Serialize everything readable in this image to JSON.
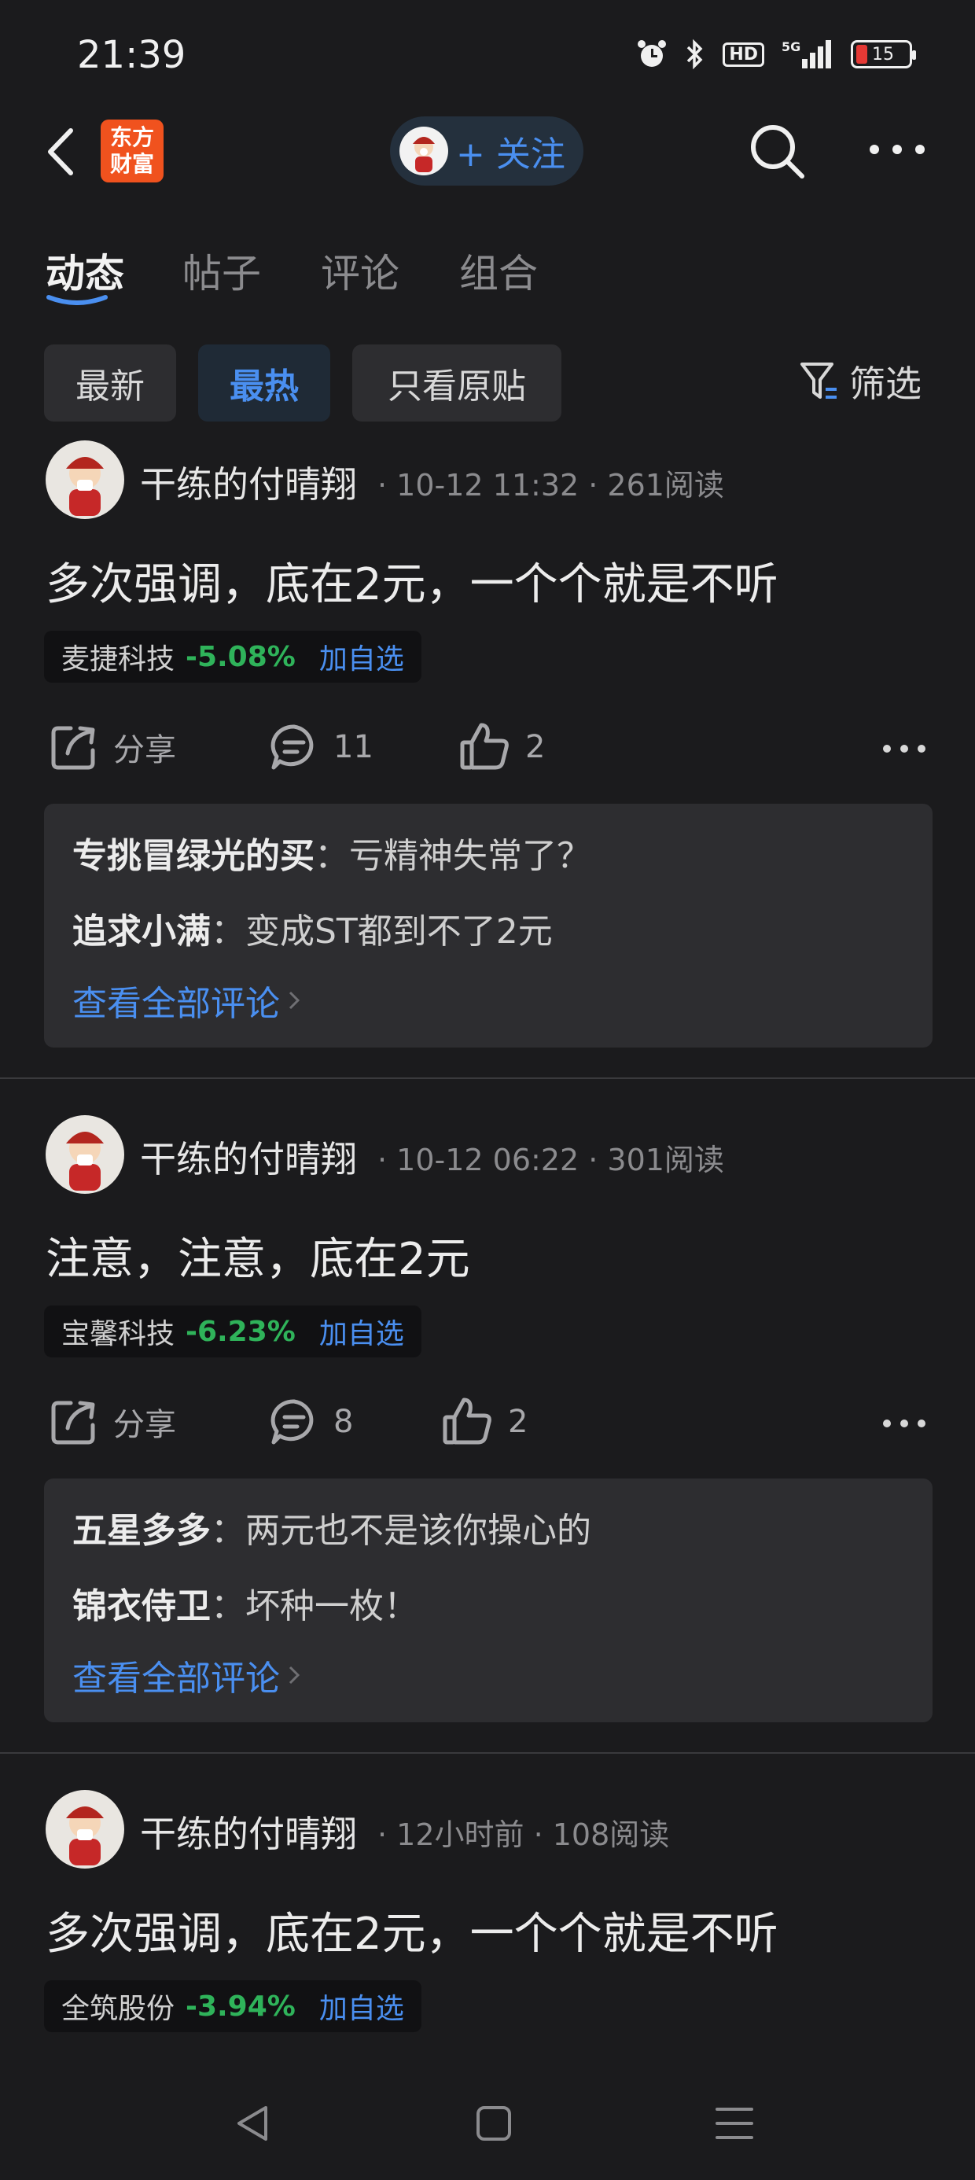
{
  "status_bar": {
    "time": "21:39",
    "hd": "HD",
    "network": "5G",
    "battery": "15"
  },
  "header": {
    "logo_text_line1": "东方",
    "logo_text_line2": "财富",
    "follow_label": "+ 关注"
  },
  "tabs": [
    {
      "label": "动态",
      "active": true
    },
    {
      "label": "帖子",
      "active": false
    },
    {
      "label": "评论",
      "active": false
    },
    {
      "label": "组合",
      "active": false
    }
  ],
  "filters": {
    "chips": [
      "最新",
      "最热",
      "只看原贴"
    ],
    "active": "最热",
    "filter_label": "筛选"
  },
  "posts": [
    {
      "author": "干练的付晴翔",
      "meta": "· 10-12 11:32 · 261阅读",
      "text": "多次强调，底在2元，一个个就是不听",
      "stock": {
        "name": "麦捷科技",
        "change": "-5.08%",
        "add": "加自选"
      },
      "share": "分享",
      "comments": "11",
      "likes": "2",
      "comment_items": [
        {
          "user": "专挑冒绿光的买",
          "sep": "：",
          "text": "亏精神失常了？"
        },
        {
          "user": "追求小满",
          "sep": "：",
          "text": "变成ST都到不了2元"
        }
      ],
      "view_all": "查看全部评论"
    },
    {
      "author": "干练的付晴翔",
      "meta": "· 10-12 06:22 · 301阅读",
      "text": "注意，注意，底在2元",
      "stock": {
        "name": "宝馨科技",
        "change": "-6.23%",
        "add": "加自选"
      },
      "share": "分享",
      "comments": "8",
      "likes": "2",
      "comment_items": [
        {
          "user": "五星多多",
          "sep": "：",
          "text": "两元也不是该你操心的"
        },
        {
          "user": "锦衣侍卫",
          "sep": "：",
          "text": "坏种一枚！"
        }
      ],
      "view_all": "查看全部评论"
    },
    {
      "author": "干练的付晴翔",
      "meta": "· 12小时前 · 108阅读",
      "text": "多次强调，底在2元，一个个就是不听",
      "stock": {
        "name": "全筑股份",
        "change": "-3.94%",
        "add": "加自选"
      }
    }
  ],
  "colors": {
    "accent": "#4a8ff0",
    "down_green": "#2fb35a",
    "logo_orange": "#f0521e",
    "background": "#1b1b1d"
  }
}
